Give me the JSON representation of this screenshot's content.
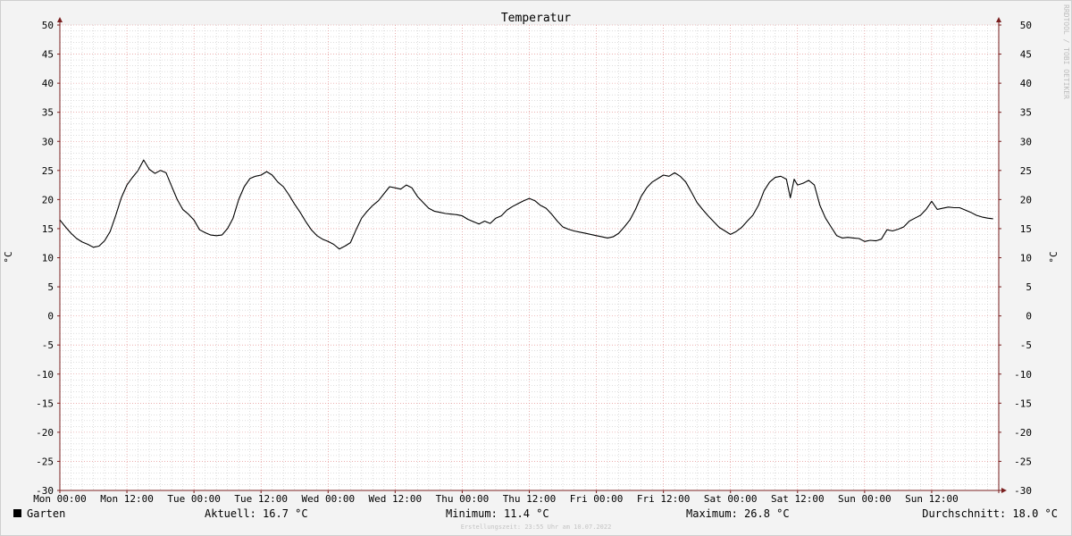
{
  "chart_data": {
    "type": "line",
    "title": "Temperatur",
    "ylabel": "°C",
    "ylim": [
      -30,
      50
    ],
    "yticks": [
      50,
      45,
      40,
      35,
      30,
      25,
      20,
      15,
      10,
      5,
      0,
      -5,
      -10,
      -15,
      -20,
      -25,
      -30
    ],
    "xlim_hours": [
      0,
      168
    ],
    "xticks": [
      {
        "hour": 0,
        "label": "Mon 00:00"
      },
      {
        "hour": 12,
        "label": "Mon 12:00"
      },
      {
        "hour": 24,
        "label": "Tue 00:00"
      },
      {
        "hour": 36,
        "label": "Tue 12:00"
      },
      {
        "hour": 48,
        "label": "Wed 00:00"
      },
      {
        "hour": 60,
        "label": "Wed 12:00"
      },
      {
        "hour": 72,
        "label": "Thu 00:00"
      },
      {
        "hour": 84,
        "label": "Thu 12:00"
      },
      {
        "hour": 96,
        "label": "Fri 00:00"
      },
      {
        "hour": 108,
        "label": "Fri 12:00"
      },
      {
        "hour": 120,
        "label": "Sat 00:00"
      },
      {
        "hour": 132,
        "label": "Sat 12:00"
      },
      {
        "hour": 144,
        "label": "Sun 00:00"
      },
      {
        "hour": 156,
        "label": "Sun 12:00"
      }
    ],
    "grid": true,
    "series": [
      {
        "name": "Garten",
        "color": "#000000",
        "points": [
          [
            0,
            16.5
          ],
          [
            1,
            15.3
          ],
          [
            2,
            14.2
          ],
          [
            3,
            13.3
          ],
          [
            4,
            12.7
          ],
          [
            5,
            12.3
          ],
          [
            6,
            11.8
          ],
          [
            7,
            12.0
          ],
          [
            8,
            12.9
          ],
          [
            9,
            14.5
          ],
          [
            10,
            17.3
          ],
          [
            11,
            20.3
          ],
          [
            12,
            22.5
          ],
          [
            13,
            23.8
          ],
          [
            14,
            25.0
          ],
          [
            15,
            26.8
          ],
          [
            16,
            25.2
          ],
          [
            17,
            24.5
          ],
          [
            18,
            25.0
          ],
          [
            19,
            24.6
          ],
          [
            20,
            22.3
          ],
          [
            21,
            20.0
          ],
          [
            22,
            18.3
          ],
          [
            23,
            17.5
          ],
          [
            24,
            16.5
          ],
          [
            25,
            14.8
          ],
          [
            26,
            14.3
          ],
          [
            27,
            13.9
          ],
          [
            28,
            13.8
          ],
          [
            29,
            13.9
          ],
          [
            30,
            15.0
          ],
          [
            31,
            16.8
          ],
          [
            32,
            20.0
          ],
          [
            33,
            22.2
          ],
          [
            34,
            23.6
          ],
          [
            35,
            24.0
          ],
          [
            36,
            24.2
          ],
          [
            37,
            24.8
          ],
          [
            38,
            24.2
          ],
          [
            39,
            23.0
          ],
          [
            40,
            22.2
          ],
          [
            41,
            20.8
          ],
          [
            42,
            19.2
          ],
          [
            43,
            17.8
          ],
          [
            44,
            16.2
          ],
          [
            45,
            14.8
          ],
          [
            46,
            13.8
          ],
          [
            47,
            13.2
          ],
          [
            48,
            12.8
          ],
          [
            49,
            12.3
          ],
          [
            50,
            11.5
          ],
          [
            51,
            12.0
          ],
          [
            52,
            12.6
          ],
          [
            53,
            14.8
          ],
          [
            54,
            16.8
          ],
          [
            55,
            18.0
          ],
          [
            56,
            19.0
          ],
          [
            57,
            19.8
          ],
          [
            58,
            21.0
          ],
          [
            59,
            22.2
          ],
          [
            60,
            22.0
          ],
          [
            61,
            21.8
          ],
          [
            62,
            22.5
          ],
          [
            63,
            22.0
          ],
          [
            64,
            20.5
          ],
          [
            65,
            19.5
          ],
          [
            66,
            18.5
          ],
          [
            67,
            18.0
          ],
          [
            68,
            17.8
          ],
          [
            69,
            17.6
          ],
          [
            70,
            17.5
          ],
          [
            71,
            17.4
          ],
          [
            72,
            17.2
          ],
          [
            73,
            16.6
          ],
          [
            74,
            16.2
          ],
          [
            75,
            15.8
          ],
          [
            76,
            16.3
          ],
          [
            77,
            15.9
          ],
          [
            78,
            16.8
          ],
          [
            79,
            17.2
          ],
          [
            80,
            18.2
          ],
          [
            81,
            18.8
          ],
          [
            82,
            19.3
          ],
          [
            83,
            19.8
          ],
          [
            84,
            20.2
          ],
          [
            85,
            19.8
          ],
          [
            86,
            19.0
          ],
          [
            87,
            18.5
          ],
          [
            88,
            17.5
          ],
          [
            89,
            16.3
          ],
          [
            90,
            15.3
          ],
          [
            91,
            14.9
          ],
          [
            92,
            14.6
          ],
          [
            93,
            14.4
          ],
          [
            94,
            14.2
          ],
          [
            95,
            14.0
          ],
          [
            96,
            13.8
          ],
          [
            97,
            13.6
          ],
          [
            98,
            13.4
          ],
          [
            99,
            13.6
          ],
          [
            100,
            14.2
          ],
          [
            101,
            15.3
          ],
          [
            102,
            16.5
          ],
          [
            103,
            18.3
          ],
          [
            104,
            20.5
          ],
          [
            105,
            22.0
          ],
          [
            106,
            23.0
          ],
          [
            107,
            23.6
          ],
          [
            108,
            24.2
          ],
          [
            109,
            24.0
          ],
          [
            110,
            24.6
          ],
          [
            111,
            24.0
          ],
          [
            112,
            23.0
          ],
          [
            113,
            21.3
          ],
          [
            114,
            19.5
          ],
          [
            115,
            18.3
          ],
          [
            116,
            17.2
          ],
          [
            117,
            16.2
          ],
          [
            118,
            15.2
          ],
          [
            119,
            14.6
          ],
          [
            120,
            14.0
          ],
          [
            121,
            14.5
          ],
          [
            122,
            15.2
          ],
          [
            123,
            16.3
          ],
          [
            124,
            17.3
          ],
          [
            125,
            19.0
          ],
          [
            126,
            21.5
          ],
          [
            127,
            23.0
          ],
          [
            128,
            23.8
          ],
          [
            129,
            24.0
          ],
          [
            130,
            23.5
          ],
          [
            130.7,
            20.3
          ],
          [
            131.4,
            23.5
          ],
          [
            132,
            22.5
          ],
          [
            133,
            22.8
          ],
          [
            134,
            23.3
          ],
          [
            135,
            22.5
          ],
          [
            136,
            19.0
          ],
          [
            137,
            16.8
          ],
          [
            138,
            15.3
          ],
          [
            139,
            13.8
          ],
          [
            140,
            13.4
          ],
          [
            141,
            13.5
          ],
          [
            142,
            13.4
          ],
          [
            143,
            13.3
          ],
          [
            144,
            12.8
          ],
          [
            145,
            13.0
          ],
          [
            146,
            12.9
          ],
          [
            147,
            13.2
          ],
          [
            148,
            14.8
          ],
          [
            149,
            14.6
          ],
          [
            150,
            14.9
          ],
          [
            151,
            15.3
          ],
          [
            152,
            16.3
          ],
          [
            153,
            16.8
          ],
          [
            154,
            17.3
          ],
          [
            155,
            18.3
          ],
          [
            156,
            19.7
          ],
          [
            157,
            18.3
          ],
          [
            158,
            18.5
          ],
          [
            159,
            18.7
          ],
          [
            160,
            18.6
          ],
          [
            161,
            18.6
          ],
          [
            162,
            18.2
          ],
          [
            163,
            17.8
          ],
          [
            164,
            17.3
          ],
          [
            165,
            17.0
          ],
          [
            166,
            16.8
          ],
          [
            167,
            16.7
          ]
        ]
      }
    ]
  },
  "legend": {
    "series_name": "Garten",
    "aktuell": "Aktuell: 16.7 °C",
    "minimum": "Minimum: 11.4 °C",
    "maximum": "Maximum: 26.8 °C",
    "durchschnitt": "Durchschnitt: 18.0 °C"
  },
  "watermark": "RRDTOOL / TOBI OETIKER",
  "footer": "Erstellungszeit: 23:55 Uhr am 10.07.2022",
  "colors": {
    "background": "#f3f3f3",
    "plot_background": "#ffffff",
    "major_grid": "#e08080",
    "minor_grid": "#bdbdbd",
    "axis": "#7a1f1f",
    "line": "#000000"
  }
}
